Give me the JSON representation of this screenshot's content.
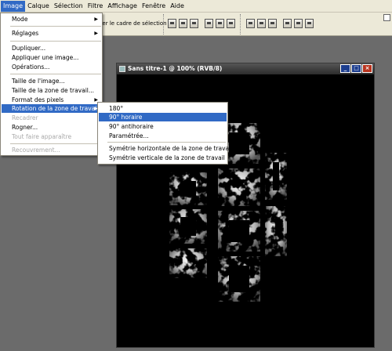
{
  "menubar": {
    "items": [
      "Image",
      "Calque",
      "Sélection",
      "Filtre",
      "Affichage",
      "Fenêtre",
      "Aide"
    ],
    "active_index": 0
  },
  "options_bar": {
    "crop_label": "ner le cadre de sélection",
    "icon_name": "align-distribute-icon"
  },
  "image_menu": {
    "items": [
      {
        "label": "Mode",
        "submenu": true,
        "enabled": true
      },
      {
        "label": "Réglages",
        "submenu": true,
        "enabled": true
      },
      {
        "label": "Dupliquer...",
        "submenu": false,
        "enabled": true
      },
      {
        "label": "Appliquer une image...",
        "submenu": false,
        "enabled": true
      },
      {
        "label": "Opérations...",
        "submenu": false,
        "enabled": true
      },
      {
        "label": "Taille de l'image...",
        "submenu": false,
        "enabled": true
      },
      {
        "label": "Taille de la zone de travail...",
        "submenu": false,
        "enabled": true
      },
      {
        "label": "Format des pixels",
        "submenu": true,
        "enabled": true
      },
      {
        "label": "Rotation de la zone de travail",
        "submenu": true,
        "enabled": true,
        "highlighted": true
      },
      {
        "label": "Recadrer",
        "submenu": false,
        "enabled": false
      },
      {
        "label": "Rogner...",
        "submenu": false,
        "enabled": true
      },
      {
        "label": "Tout faire apparaître",
        "submenu": false,
        "enabled": false
      },
      {
        "label": "Recouvrement...",
        "submenu": false,
        "enabled": false
      }
    ]
  },
  "rotation_submenu": {
    "items": [
      {
        "label": "180°"
      },
      {
        "label": "90° horaire",
        "highlighted": true
      },
      {
        "label": "90° antihoraire"
      },
      {
        "label": "Paramétrée..."
      },
      {
        "label": "Symétrie horizontale de la zone de travail"
      },
      {
        "label": "Symétrie verticale de la zone de travail"
      }
    ]
  },
  "document": {
    "title": "Sans titre-1 @ 100% (RVB/8)",
    "minimize_label": "_",
    "maximize_label": "□",
    "close_label": "×",
    "artwork_icon": "grunge-text-artwork-icon"
  },
  "colors": {
    "menu_highlight": "#316ac5",
    "chrome": "#ece9d8",
    "workspace": "#6b6b6b"
  }
}
